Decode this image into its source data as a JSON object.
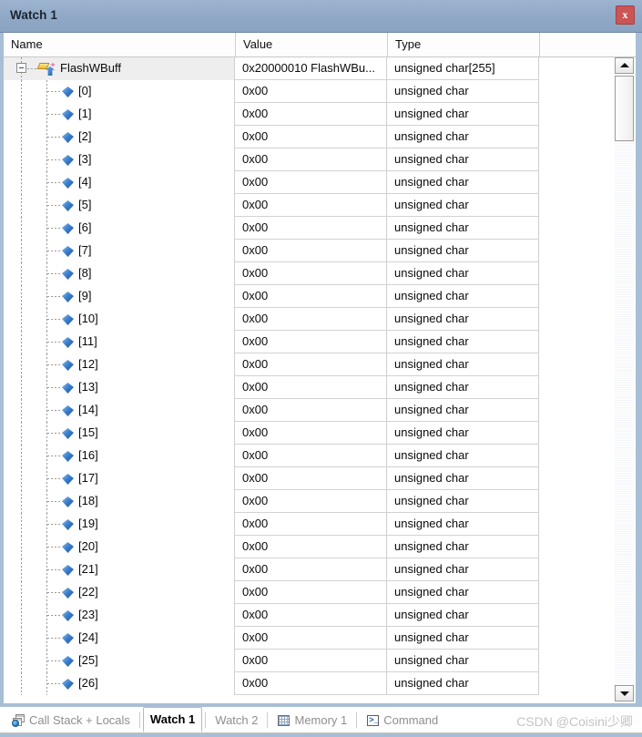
{
  "window": {
    "title": "Watch 1",
    "close_label": "x",
    "titlebar_color": "#91a9c6",
    "close_color": "#cb5555"
  },
  "grid": {
    "columns": [
      "Name",
      "Value",
      "Type",
      ""
    ],
    "rows": [
      {
        "name": "FlashWBuff",
        "value": "0x20000010 FlashWBu...",
        "type": "unsigned char[255]",
        "level": 0,
        "expanded": true,
        "selected": true,
        "icon": "array-variable-icon"
      },
      {
        "name": "[0]",
        "value": "0x00",
        "type": "unsigned char",
        "level": 1,
        "icon": "element-icon"
      },
      {
        "name": "[1]",
        "value": "0x00",
        "type": "unsigned char",
        "level": 1,
        "icon": "element-icon"
      },
      {
        "name": "[2]",
        "value": "0x00",
        "type": "unsigned char",
        "level": 1,
        "icon": "element-icon"
      },
      {
        "name": "[3]",
        "value": "0x00",
        "type": "unsigned char",
        "level": 1,
        "icon": "element-icon"
      },
      {
        "name": "[4]",
        "value": "0x00",
        "type": "unsigned char",
        "level": 1,
        "icon": "element-icon"
      },
      {
        "name": "[5]",
        "value": "0x00",
        "type": "unsigned char",
        "level": 1,
        "icon": "element-icon"
      },
      {
        "name": "[6]",
        "value": "0x00",
        "type": "unsigned char",
        "level": 1,
        "icon": "element-icon"
      },
      {
        "name": "[7]",
        "value": "0x00",
        "type": "unsigned char",
        "level": 1,
        "icon": "element-icon"
      },
      {
        "name": "[8]",
        "value": "0x00",
        "type": "unsigned char",
        "level": 1,
        "icon": "element-icon"
      },
      {
        "name": "[9]",
        "value": "0x00",
        "type": "unsigned char",
        "level": 1,
        "icon": "element-icon"
      },
      {
        "name": "[10]",
        "value": "0x00",
        "type": "unsigned char",
        "level": 1,
        "icon": "element-icon"
      },
      {
        "name": "[11]",
        "value": "0x00",
        "type": "unsigned char",
        "level": 1,
        "icon": "element-icon"
      },
      {
        "name": "[12]",
        "value": "0x00",
        "type": "unsigned char",
        "level": 1,
        "icon": "element-icon"
      },
      {
        "name": "[13]",
        "value": "0x00",
        "type": "unsigned char",
        "level": 1,
        "icon": "element-icon"
      },
      {
        "name": "[14]",
        "value": "0x00",
        "type": "unsigned char",
        "level": 1,
        "icon": "element-icon"
      },
      {
        "name": "[15]",
        "value": "0x00",
        "type": "unsigned char",
        "level": 1,
        "icon": "element-icon"
      },
      {
        "name": "[16]",
        "value": "0x00",
        "type": "unsigned char",
        "level": 1,
        "icon": "element-icon"
      },
      {
        "name": "[17]",
        "value": "0x00",
        "type": "unsigned char",
        "level": 1,
        "icon": "element-icon"
      },
      {
        "name": "[18]",
        "value": "0x00",
        "type": "unsigned char",
        "level": 1,
        "icon": "element-icon"
      },
      {
        "name": "[19]",
        "value": "0x00",
        "type": "unsigned char",
        "level": 1,
        "icon": "element-icon"
      },
      {
        "name": "[20]",
        "value": "0x00",
        "type": "unsigned char",
        "level": 1,
        "icon": "element-icon"
      },
      {
        "name": "[21]",
        "value": "0x00",
        "type": "unsigned char",
        "level": 1,
        "icon": "element-icon"
      },
      {
        "name": "[22]",
        "value": "0x00",
        "type": "unsigned char",
        "level": 1,
        "icon": "element-icon"
      },
      {
        "name": "[23]",
        "value": "0x00",
        "type": "unsigned char",
        "level": 1,
        "icon": "element-icon"
      },
      {
        "name": "[24]",
        "value": "0x00",
        "type": "unsigned char",
        "level": 1,
        "icon": "element-icon"
      },
      {
        "name": "[25]",
        "value": "0x00",
        "type": "unsigned char",
        "level": 1,
        "icon": "element-icon"
      },
      {
        "name": "[26]",
        "value": "0x00",
        "type": "unsigned char",
        "level": 1,
        "icon": "element-icon"
      }
    ]
  },
  "scrollbar": {
    "up_arrow": "▲",
    "down_arrow": "▼"
  },
  "tabbar": {
    "tabs": [
      {
        "label": "Call Stack + Locals",
        "icon": "call-stack-icon",
        "active": false
      },
      {
        "label": "Watch 1",
        "icon": "",
        "active": true
      },
      {
        "label": "Watch 2",
        "icon": "",
        "active": false
      },
      {
        "label": "Memory 1",
        "icon": "memory-grid-icon",
        "active": false
      },
      {
        "label": "Command",
        "icon": "command-prompt-icon",
        "active": false
      }
    ],
    "command_icon_glyph": ">_",
    "watermark": "CSDN @Coisini少卿"
  }
}
